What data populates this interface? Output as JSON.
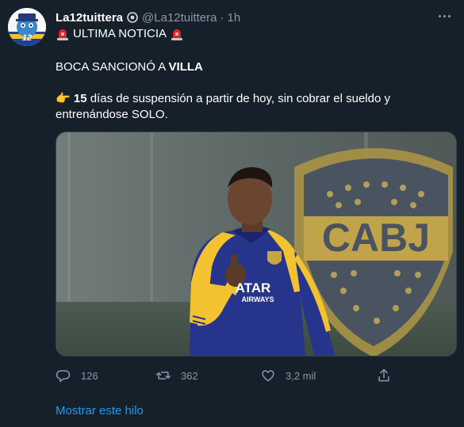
{
  "tweet": {
    "author_name": "La12tuittera",
    "handle": "@La12tuittera",
    "separator": "·",
    "time": "1h",
    "line1_text": "ULTIMA NOTICIA",
    "line2_prefix": "BOCA SANCIONÓ A ",
    "line2_bold": "VILLA",
    "line3_emoji": "👉",
    "line3_bold": "15",
    "line3_rest": " días de suspensión a partir de hoy, sin cobrar el sueldo y entrenándose SOLO.",
    "image_text": {
      "crest": "CABJ",
      "shirt_sponsor_1": "ATAR",
      "shirt_sponsor_2": "AIRWAYS"
    },
    "icons": {
      "verified_badge": "verified-badge-icon",
      "more": "more-icon",
      "siren": "police-light-icon",
      "pointing": "backhand-index-pointing-right-icon",
      "reply": "reply-icon",
      "retweet": "retweet-icon",
      "like": "heart-icon",
      "share": "share-icon"
    }
  },
  "actions": {
    "reply_count": "126",
    "retweet_count": "362",
    "like_count": "3,2 mil"
  },
  "show_thread": "Mostrar este hilo",
  "colors": {
    "background": "#15202b",
    "secondary_text": "#8b98a5",
    "link": "#1d9bf0",
    "boca_blue": "#1b2a8f",
    "boca_gold": "#f2c230"
  }
}
